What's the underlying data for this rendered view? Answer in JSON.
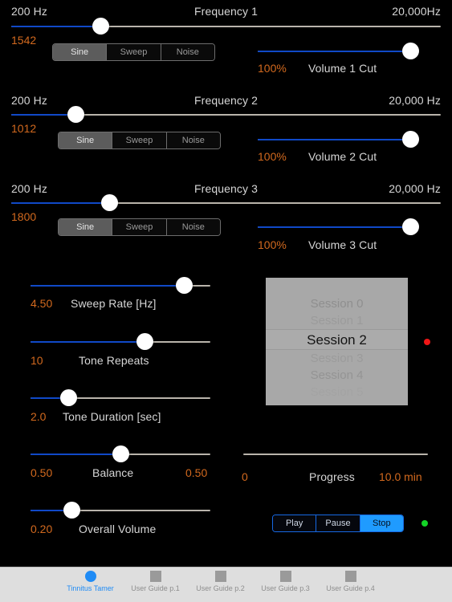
{
  "app": {
    "title": "Tinnitus Tamer"
  },
  "frequency_groups": [
    {
      "min_label": "200 Hz",
      "title": "Frequency 1",
      "max_label": "20,000Hz",
      "value": "1542",
      "slider_pct": 20.8,
      "wave_options": [
        "Sine",
        "Sweep",
        "Noise"
      ],
      "wave_selected": 0,
      "volume": {
        "value": "100%",
        "label": "Volume 1 Cut",
        "slider_pct": 100
      }
    },
    {
      "min_label": "200 Hz",
      "title": "Frequency 2",
      "max_label": "20,000 Hz",
      "value": "1012",
      "slider_pct": 15.1,
      "wave_options": [
        "Sine",
        "Sweep",
        "Noise"
      ],
      "wave_selected": 0,
      "volume": {
        "value": "100%",
        "label": "Volume 2 Cut",
        "slider_pct": 100
      }
    },
    {
      "min_label": "200 Hz",
      "title": "Frequency 3",
      "max_label": "20,000 Hz",
      "value": "1800",
      "slider_pct": 22.9,
      "wave_options": [
        "Sine",
        "Sweep",
        "Noise"
      ],
      "wave_selected": 0,
      "volume": {
        "value": "100%",
        "label": "Volume 3 Cut",
        "slider_pct": 100
      }
    }
  ],
  "param_sliders": [
    {
      "value": "4.50",
      "label": "Sweep Rate [Hz]",
      "slider_pct": 85.3,
      "right_value": ""
    },
    {
      "value": "10",
      "label": "Tone Repeats",
      "slider_pct": 63.4,
      "right_value": ""
    },
    {
      "value": "2.0",
      "label": "Tone Duration [sec]",
      "slider_pct": 21.4,
      "right_value": ""
    },
    {
      "value": "0.50",
      "label": "Balance",
      "slider_pct": 50.0,
      "right_value": "0.50"
    },
    {
      "value": "0.20",
      "label": "Overall Volume",
      "slider_pct": 22.8,
      "right_value": ""
    }
  ],
  "session_picker": {
    "rows": [
      "Session 0",
      "Session 1",
      "Session 2",
      "Session 3",
      "Session 4",
      "Session 5"
    ],
    "selected_index": 2,
    "status_led_color": "#f01616"
  },
  "progress": {
    "left_value": "0",
    "label": "Progress",
    "right_value": "10.0 min",
    "percent": 0
  },
  "transport": {
    "buttons": [
      "Play",
      "Pause",
      "Stop"
    ],
    "selected": 2,
    "status_led_color": "#13d426"
  },
  "tabs": [
    {
      "label": "Tinnitus Tamer",
      "icon": "circle-icon",
      "active": true
    },
    {
      "label": "User Guide p.1",
      "icon": "square-icon",
      "active": false
    },
    {
      "label": "User Guide p.2",
      "icon": "square-icon",
      "active": false
    },
    {
      "label": "User Guide p.3",
      "icon": "square-icon",
      "active": false
    },
    {
      "label": "User Guide p.4",
      "icon": "square-icon",
      "active": false
    }
  ],
  "colors": {
    "accent_blue": "#1049c8",
    "value_orange": "#c8601a",
    "tab_active": "#1f8bf5",
    "track_grey": "#b9b4ab"
  }
}
